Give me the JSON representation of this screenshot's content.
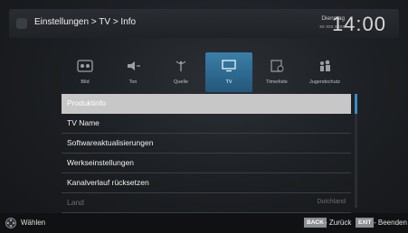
{
  "header": {
    "breadcrumb": "Einstellungen > TV > Info",
    "weekday": "Dienstag",
    "date": "xx xxx xxxx",
    "time": "14:00"
  },
  "tabs": [
    {
      "label": "Bild",
      "icon": "picture-icon",
      "active": false
    },
    {
      "label": "Ton",
      "icon": "speaker-icon",
      "active": false
    },
    {
      "label": "Quelle",
      "icon": "antenna-icon",
      "active": false
    },
    {
      "label": "TV",
      "icon": "tv-icon",
      "active": true
    },
    {
      "label": "Timerliste",
      "icon": "timer-list-icon",
      "active": false
    },
    {
      "label": "Jugendschutz",
      "icon": "parental-lock-icon",
      "active": false
    }
  ],
  "menu": {
    "items": [
      {
        "label": "Produktinfo",
        "value": "",
        "state": "selected"
      },
      {
        "label": "TV Name",
        "value": "",
        "state": "normal"
      },
      {
        "label": "Softwareaktualisierungen",
        "value": "",
        "state": "normal"
      },
      {
        "label": "Werkseinstellungen",
        "value": "",
        "state": "normal"
      },
      {
        "label": "Kanalverlauf rücksetzen",
        "value": "",
        "state": "normal"
      },
      {
        "label": "Land",
        "value": "Dutchland",
        "state": "disabled"
      }
    ]
  },
  "footer": {
    "select_label": "Wählen",
    "back_key": "BACK",
    "back_label": "- Zurück",
    "exit_key": "EXIT",
    "exit_label": "- Beenden"
  },
  "colors": {
    "accent": "#2f6f98",
    "selected_row": "#c7c7c7",
    "disabled_text": "#6b6e73"
  }
}
